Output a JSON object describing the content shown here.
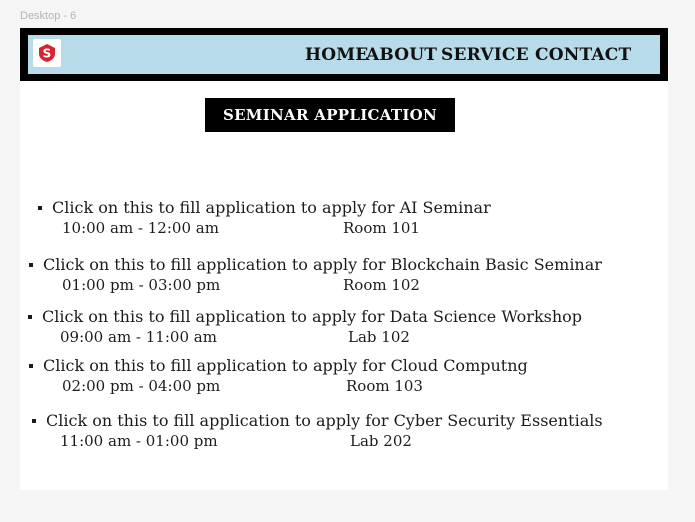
{
  "frame_label": "Desktop - 6",
  "brand": {
    "logo_icon": "s-logo-icon",
    "logo_letter": "S",
    "logo_color": "#d9232e"
  },
  "nav": {
    "home": "HOME",
    "about": "ABOUT",
    "service": "SERVICE",
    "contact": "CONTACT"
  },
  "page_title": "SEMINAR APPLICATION",
  "seminars": [
    {
      "text": "Click on this to fill application to apply for  AI Seminar",
      "time": "10:00 am - 12:00 am",
      "room": "Room 101"
    },
    {
      "text": "Click on this to fill application to apply for Blockchain Basic Seminar",
      "time": "01:00 pm - 03:00 pm",
      "room": "Room 102"
    },
    {
      "text": "Click on this to fill application to apply for  Data Science Workshop",
      "time": "09:00 am - 11:00 am",
      "room": "Lab 102"
    },
    {
      "text": "Click on this to fill application to apply for  Cloud Computng",
      "time": "02:00 pm - 04:00 pm",
      "room": "Room 103"
    },
    {
      "text": "Click on this to fill application to apply for  Cyber Security Essentials",
      "time": "11:00 am - 01:00 pm",
      "room": "Lab 202"
    }
  ],
  "colors": {
    "nav_bg": "#b8dbea",
    "nav_border": "#000000",
    "title_bg": "#000000",
    "title_text": "#ffffff"
  }
}
